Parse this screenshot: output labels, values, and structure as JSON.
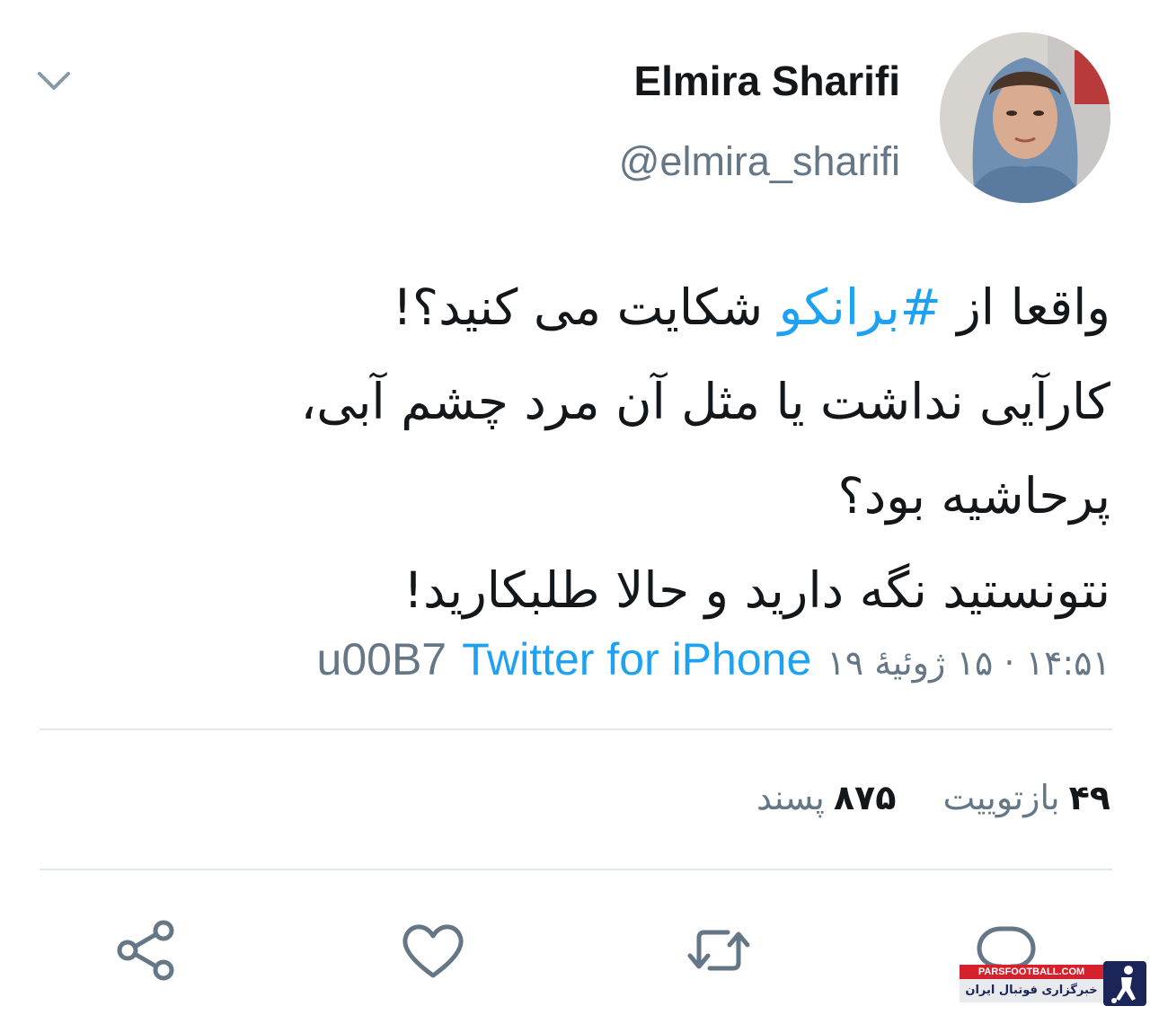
{
  "profile": {
    "display_name": "Elmira Sharifi",
    "handle": "@elmira_sharifi"
  },
  "tweet": {
    "line1_before": "واقعا از ",
    "hashtag": "#برانکو",
    "line1_after": " شکایت می کنید؟!",
    "line2": "کارآیی نداشت یا مثل آن مرد چشم آبی،",
    "line3": "پرحاشیه بود؟",
    "line4": "نتونستید نگه دارید و حالا طلبکارید!"
  },
  "meta": {
    "timestamp": "۱۴:۵۱ · ۱۵ ژوئیهٔ ۱۹",
    "separator": "u00B7",
    "source": "Twitter for iPhone"
  },
  "stats": {
    "retweets_count": "۴۹",
    "retweets_label": "بازتوییت",
    "likes_count": "۸۷۵",
    "likes_label": "پسند"
  },
  "icons": {
    "chevron": "chevron-down-icon",
    "reply": "reply-icon",
    "retweet": "retweet-icon",
    "like": "heart-icon",
    "share": "share-icon"
  },
  "colors": {
    "accent": "#1da1f2",
    "secondary_text": "#657786",
    "icon": "#657786",
    "divider": "#e1e8ed"
  },
  "watermark": {
    "site": "PARSFOOTBALL.COM",
    "tagline": "خبرگزاری فوتبال ایران"
  }
}
